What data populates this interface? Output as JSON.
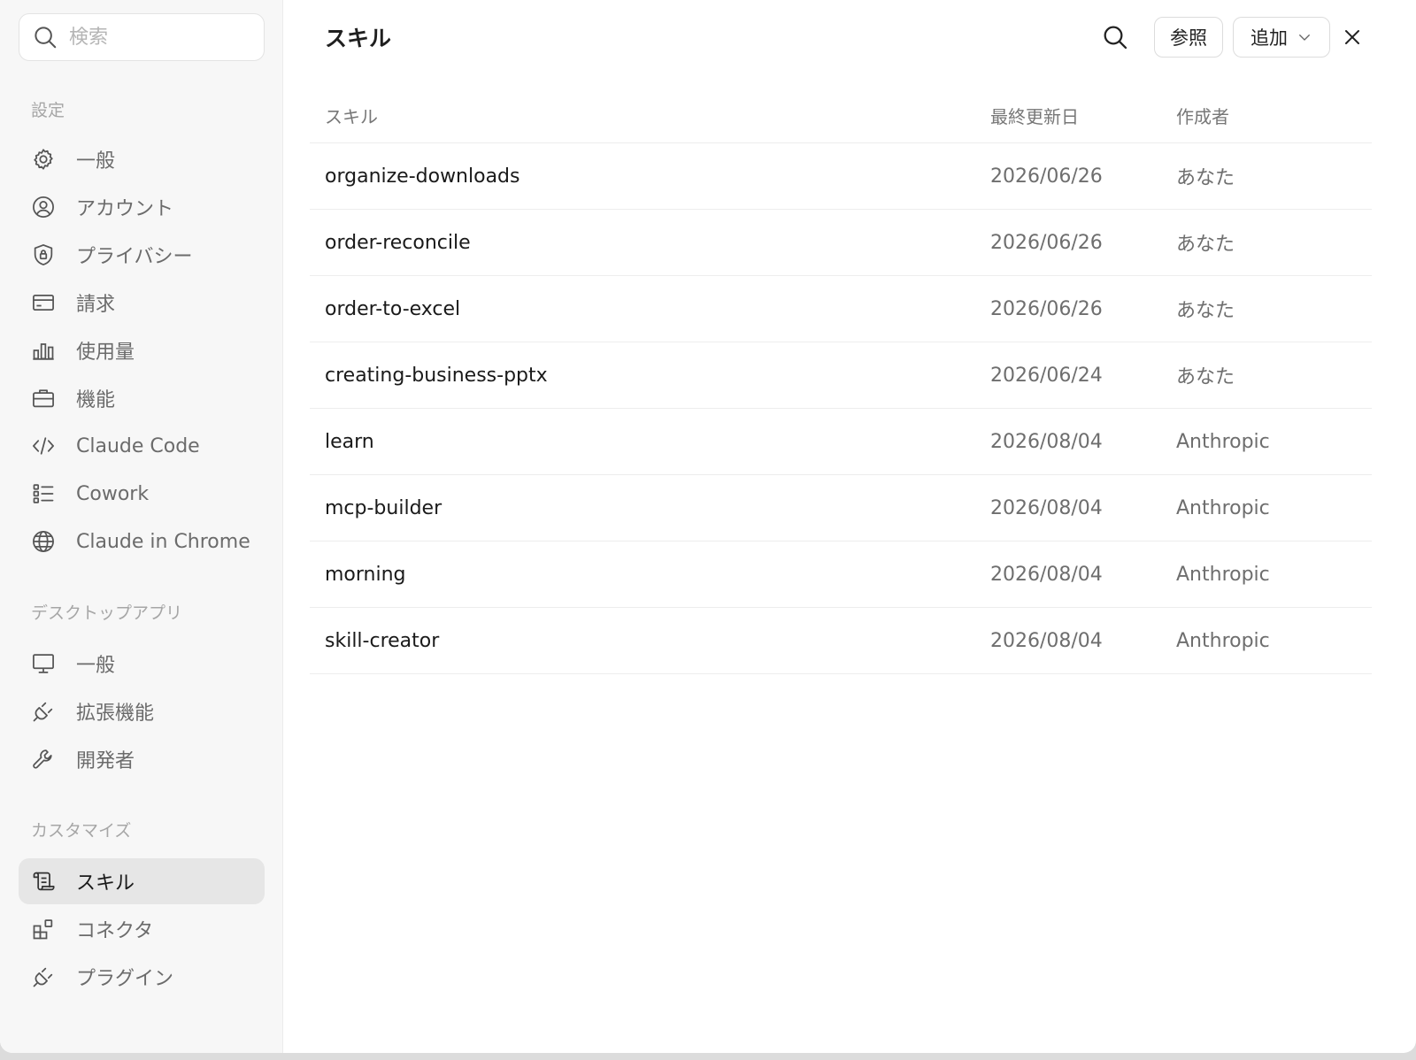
{
  "sidebar": {
    "search_placeholder": "検索",
    "sections": [
      {
        "label": "設定",
        "items": [
          {
            "label": "一般",
            "icon": "gear-icon"
          },
          {
            "label": "アカウント",
            "icon": "user-circle-icon"
          },
          {
            "label": "プライバシー",
            "icon": "shield-icon"
          },
          {
            "label": "請求",
            "icon": "credit-card-icon"
          },
          {
            "label": "使用量",
            "icon": "bar-chart-icon"
          },
          {
            "label": "機能",
            "icon": "briefcase-icon"
          },
          {
            "label": "Claude Code",
            "icon": "code-icon"
          },
          {
            "label": "Cowork",
            "icon": "checklist-icon"
          },
          {
            "label": "Claude in Chrome",
            "icon": "globe-icon"
          }
        ]
      },
      {
        "label": "デスクトップアプリ",
        "items": [
          {
            "label": "一般",
            "icon": "monitor-icon"
          },
          {
            "label": "拡張機能",
            "icon": "plug-icon"
          },
          {
            "label": "開発者",
            "icon": "wrench-icon"
          }
        ]
      },
      {
        "label": "カスタマイズ",
        "items": [
          {
            "label": "スキル",
            "icon": "scroll-icon",
            "active": true
          },
          {
            "label": "コネクタ",
            "icon": "blocks-icon"
          },
          {
            "label": "プラグイン",
            "icon": "plug-icon"
          }
        ]
      }
    ]
  },
  "header": {
    "title": "スキル",
    "browse_label": "参照",
    "add_label": "追加"
  },
  "table": {
    "columns": [
      "スキル",
      "最終更新日",
      "作成者"
    ],
    "rows": [
      {
        "name": "organize-downloads",
        "updated": "2026/06/26",
        "author": "あなた"
      },
      {
        "name": "order-reconcile",
        "updated": "2026/06/26",
        "author": "あなた"
      },
      {
        "name": "order-to-excel",
        "updated": "2026/06/26",
        "author": "あなた"
      },
      {
        "name": "creating-business-pptx",
        "updated": "2026/06/24",
        "author": "あなた"
      },
      {
        "name": "learn",
        "updated": "2026/08/04",
        "author": "Anthropic"
      },
      {
        "name": "mcp-builder",
        "updated": "2026/08/04",
        "author": "Anthropic"
      },
      {
        "name": "morning",
        "updated": "2026/08/04",
        "author": "Anthropic"
      },
      {
        "name": "skill-creator",
        "updated": "2026/08/04",
        "author": "Anthropic"
      }
    ]
  }
}
